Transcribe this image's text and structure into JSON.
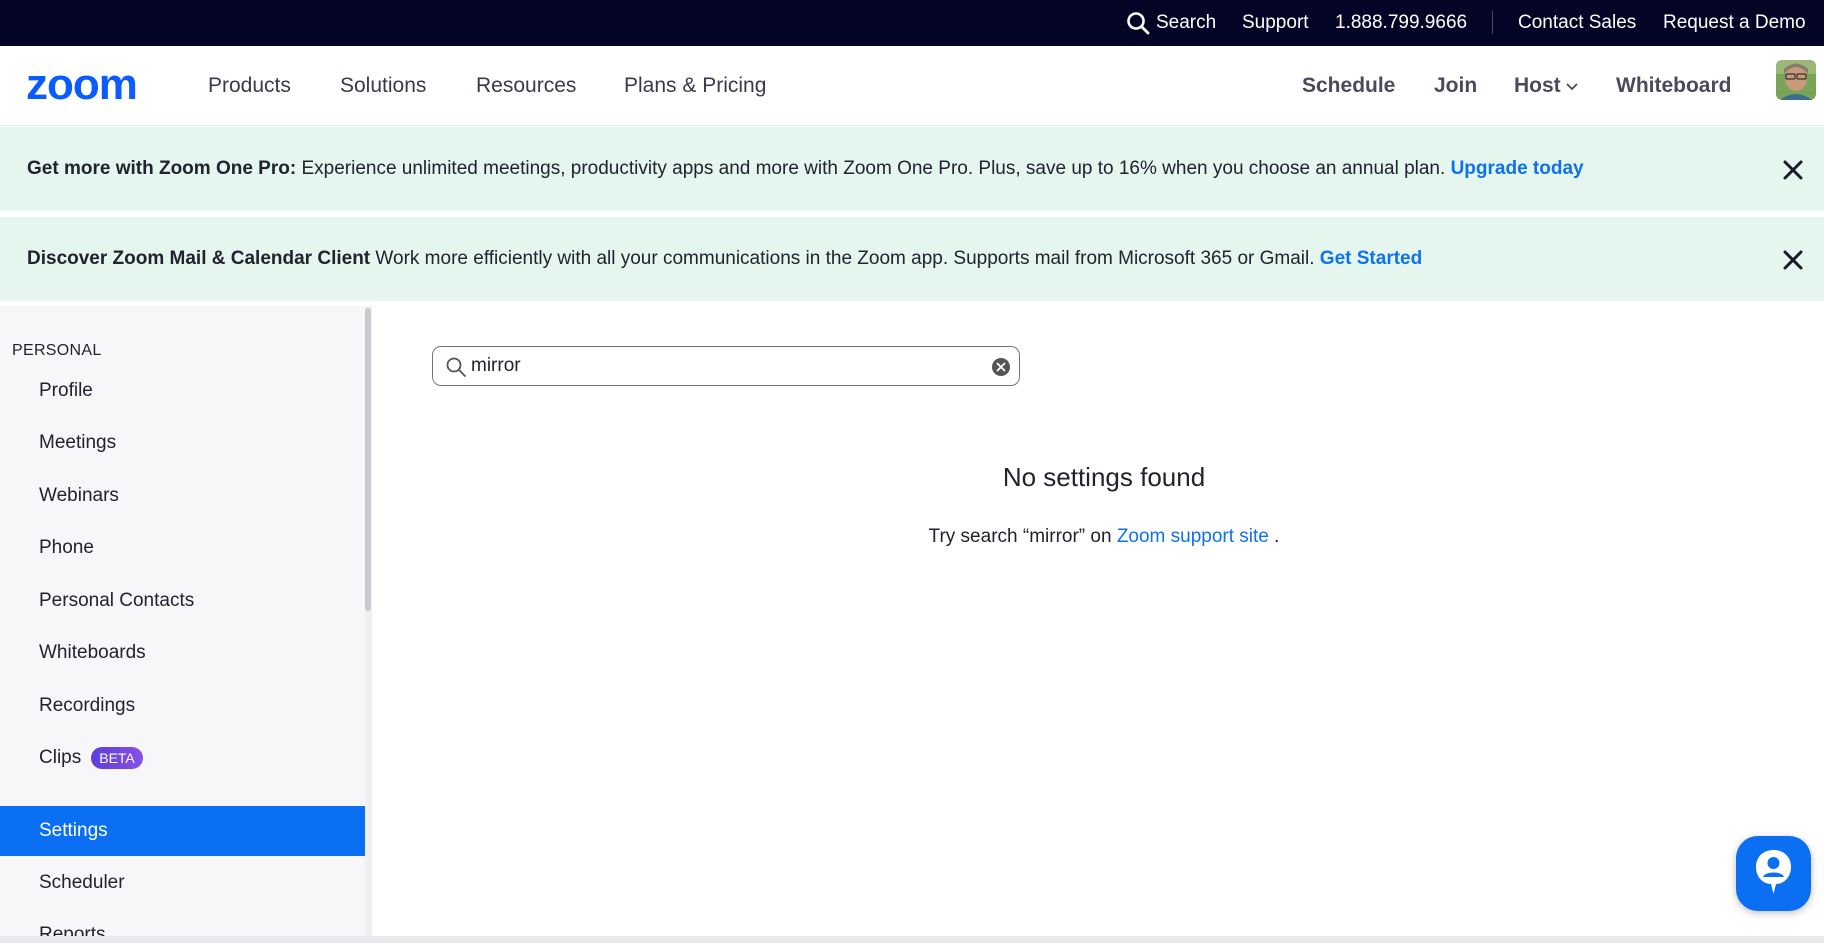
{
  "topbar": {
    "search_label": "Search",
    "support": "Support",
    "phone": "1.888.799.9666",
    "contact_sales": "Contact Sales",
    "request_demo": "Request a Demo",
    "background": "#040426"
  },
  "nav": {
    "logo_text": "zoom",
    "products": "Products",
    "solutions": "Solutions",
    "resources": "Resources",
    "plans": "Plans & Pricing",
    "schedule": "Schedule",
    "join": "Join",
    "host": "Host",
    "whiteboard": "Whiteboard"
  },
  "banner1": {
    "bold": "Get more with Zoom One Pro:",
    "text": " Experience unlimited meetings, productivity apps and more with Zoom One Pro. Plus, save up to 16% when you choose an annual plan. ",
    "link": "Upgrade today"
  },
  "banner2": {
    "bold": "Discover Zoom Mail & Calendar Client",
    "text": " Work more efficiently with all your communications in the Zoom app. Supports mail from Microsoft 365 or Gmail. ",
    "link": "Get Started"
  },
  "sidebar": {
    "section": "PERSONAL",
    "items": [
      {
        "label": "Profile"
      },
      {
        "label": "Meetings"
      },
      {
        "label": "Webinars"
      },
      {
        "label": "Phone"
      },
      {
        "label": "Personal Contacts"
      },
      {
        "label": "Whiteboards"
      },
      {
        "label": "Recordings"
      },
      {
        "label": "Clips",
        "badge": "BETA"
      },
      {
        "label": "Settings",
        "active": true
      },
      {
        "label": "Scheduler"
      },
      {
        "label": "Reports"
      }
    ],
    "active_color": "#0b6ff4"
  },
  "search": {
    "value": "mirror"
  },
  "empty": {
    "title": "No settings found",
    "hint_prefix": "Try search “mirror” on ",
    "hint_link": "Zoom support site",
    "hint_suffix": " ."
  },
  "colors": {
    "accent": "#0e72ed",
    "banner_bg": "#e5f6ee"
  }
}
